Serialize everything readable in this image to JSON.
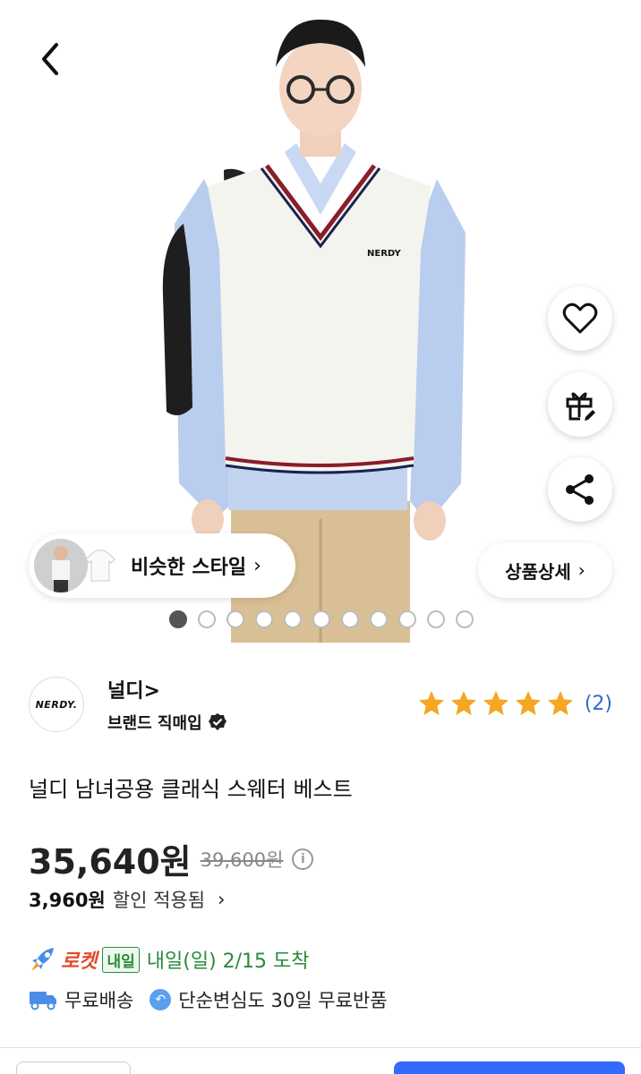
{
  "hero": {
    "similar_style_label": "비슷한 스타일",
    "product_detail_label": "상품상세",
    "carousel": {
      "total": 11,
      "active": 1
    },
    "vest_logo": "NERDY"
  },
  "brand": {
    "logo_text": "NERDY.",
    "name": "널디>",
    "sub_label": "브랜드 직매입",
    "rating_stars": 5,
    "review_count": "(2)"
  },
  "product": {
    "title": "널디 남녀공용 클래식 스웨터 베스트",
    "price": "35,640원",
    "original_price": "39,600원",
    "discount_amount": "3,960원",
    "discount_text": "할인 적용됨"
  },
  "delivery": {
    "rocket_label": "로켓",
    "naeil_badge": "내일",
    "arrival_text": "내일(일) 2/15 도착",
    "free_shipping": "무료배송",
    "return_text": "단순변심도 30일 무료반품"
  },
  "colors": {
    "rocket": "#e24b2b",
    "arrival_green": "#2a8b3a",
    "star_orange": "#f5a623",
    "link_blue": "#3468c8",
    "primary_blue": "#346aff"
  }
}
